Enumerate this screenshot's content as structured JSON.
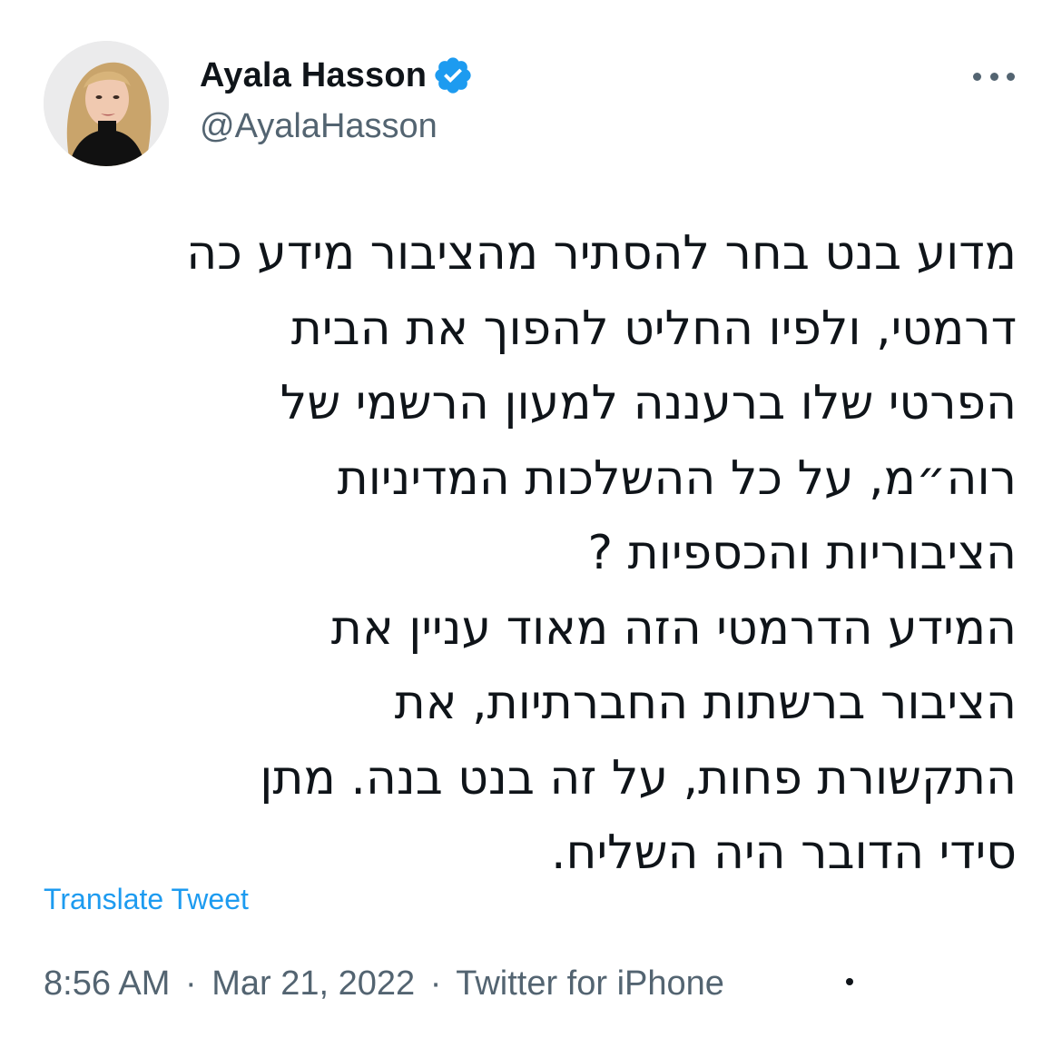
{
  "author": {
    "display_name": "Ayala Hasson",
    "handle": "@AyalaHasson",
    "verified": true
  },
  "tweet": {
    "lines": [
      "מדוע בנט בחר להסתיר מהציבור מידע כה",
      "דרמטי, ולפיו החליט להפוך את הבית",
      "הפרטי שלו ברעננה למעון הרשמי של",
      "רוה״מ, על כל ההשלכות המדיניות",
      "הציבוריות והכספיות ?",
      "המידע  הדרמטי הזה מאוד עניין את",
      "הציבור ברשתות החברתיות, את",
      "התקשורת פחות, על זה בנט בנה. מתן",
      "סידי הדובר היה השליח."
    ]
  },
  "translate_label": "Translate Tweet",
  "meta": {
    "time": "8:56 AM",
    "separator": "·",
    "date": "Mar 21, 2022",
    "source": "Twitter for iPhone"
  },
  "colors": {
    "text": "#0f1419",
    "secondary": "#536471",
    "link": "#1d9bf0",
    "verified_badge": "#1d9bf0"
  },
  "icons": {
    "verified": "verified-badge-icon",
    "more": "more-options-icon"
  }
}
